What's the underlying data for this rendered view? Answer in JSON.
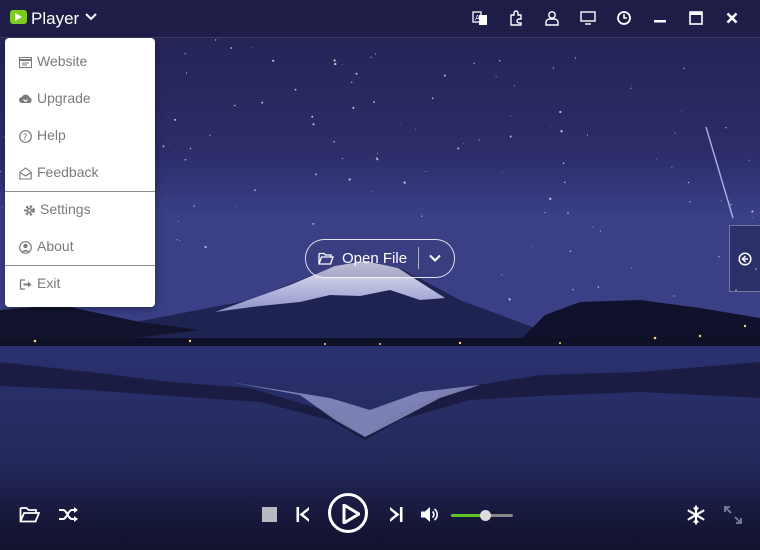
{
  "app": {
    "title": "Player"
  },
  "menu": {
    "items": [
      {
        "label": "Website",
        "icon": "website-icon"
      },
      {
        "label": "Upgrade",
        "icon": "cloud-download-icon"
      },
      {
        "label": "Help",
        "icon": "help-circle-icon"
      },
      {
        "label": "Feedback",
        "icon": "envelope-open-icon"
      },
      {
        "label": "Settings",
        "icon": "gear-icon"
      },
      {
        "label": "About",
        "icon": "user-circle-icon"
      },
      {
        "label": "Exit",
        "icon": "exit-icon"
      }
    ]
  },
  "center": {
    "open_file_label": "Open File"
  },
  "playback": {
    "volume": 0.55
  },
  "colors": {
    "accent": "#5fc421",
    "logo": "#7ecb20",
    "menu_text": "#7a7a7a"
  }
}
